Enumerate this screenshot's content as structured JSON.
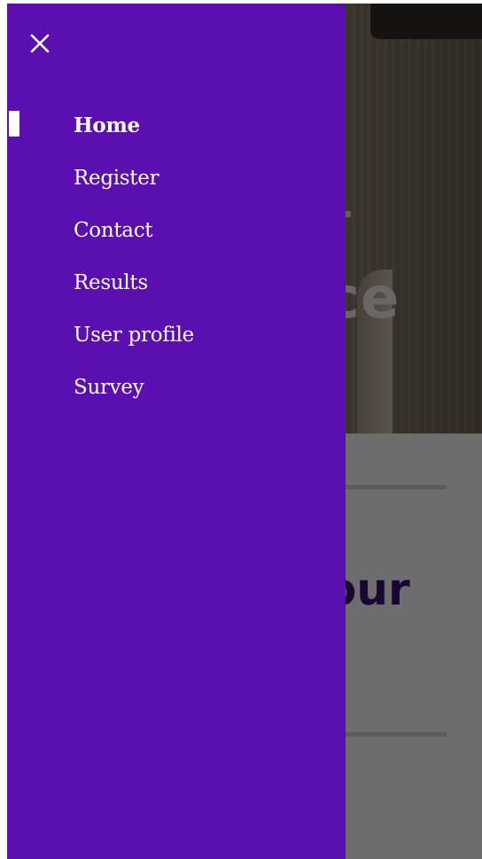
{
  "background": {
    "hero_heading": "ce",
    "section_heading": "our"
  },
  "drawer": {
    "close_icon": "close-icon",
    "items": [
      {
        "label": "Home",
        "active": true
      },
      {
        "label": "Register",
        "active": false
      },
      {
        "label": "Contact",
        "active": false
      },
      {
        "label": "Results",
        "active": false
      },
      {
        "label": "User profile",
        "active": false
      },
      {
        "label": "Survey",
        "active": false
      }
    ]
  },
  "colors": {
    "drawer_bg": "#5b0fb0",
    "nav_text": "#ffffff",
    "section_heading": "#3a0e72"
  }
}
